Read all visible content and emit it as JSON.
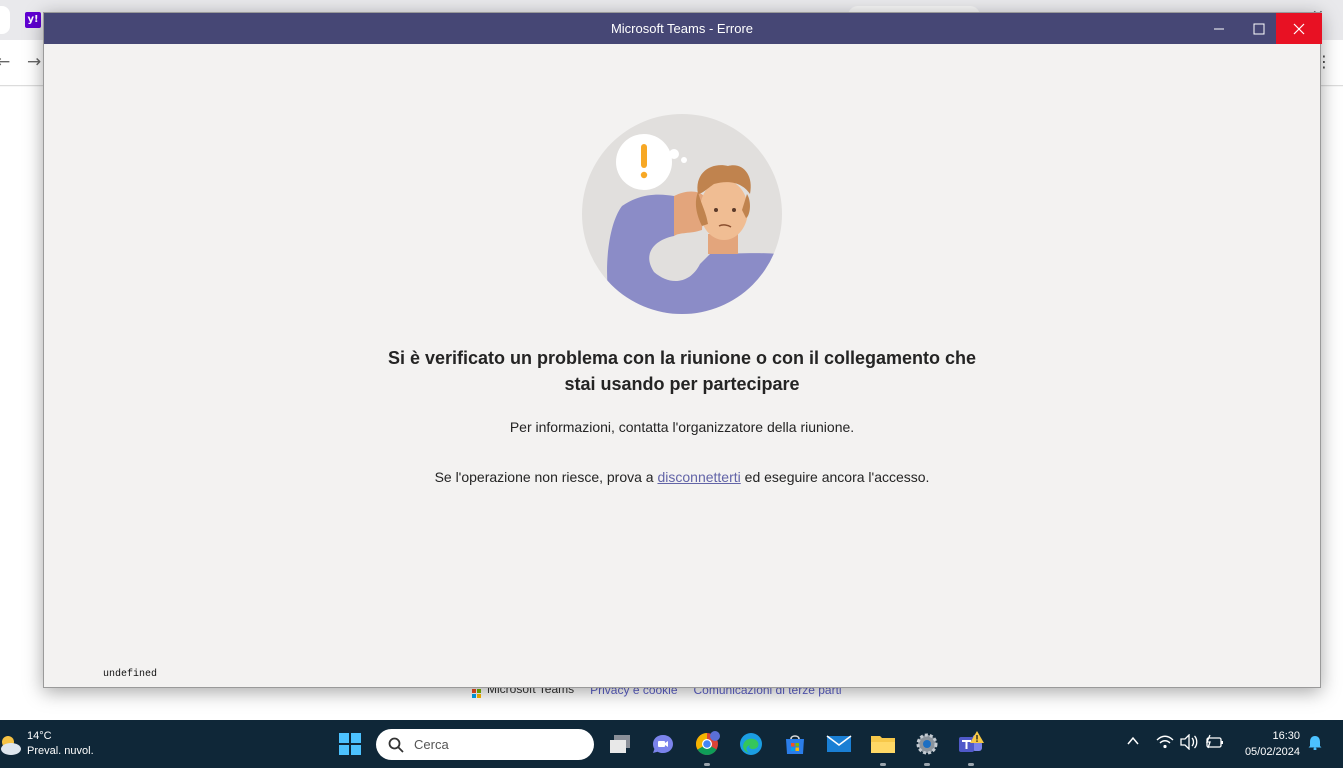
{
  "browser": {
    "tab_icon_text": "y!",
    "footer": {
      "brand": "Microsoft Teams",
      "privacy_link": "Privacy e cookie",
      "third_party_link": "Comunicazioni di terze parti"
    }
  },
  "window": {
    "title": "Microsoft Teams - Errore",
    "heading": "Si è verificato un problema con la riunione o con il collegamento che stai usando per partecipare",
    "info": "Per informazioni, contatta l'organizzatore della riunione.",
    "retry_prefix": "Se l'operazione non riesce, prova a ",
    "retry_link": "disconnetterti",
    "retry_suffix": " ed eseguire ancora l'accesso.",
    "debug_text": "undefined"
  },
  "taskbar": {
    "weather_temp": "14°C",
    "weather_condition": "Preval. nuvol.",
    "search_placeholder": "Cerca",
    "time": "16:30",
    "date": "05/02/2024",
    "icons": [
      "start-icon",
      "search-icon",
      "task-view-icon",
      "teams-chat-icon",
      "chrome-icon",
      "edge-icon",
      "store-icon",
      "mail-icon",
      "file-explorer-icon",
      "settings-icon",
      "teams-icon"
    ]
  },
  "colors": {
    "titlebar": "#464775",
    "close_button": "#e81123",
    "window_background": "#f3f2f1",
    "link": "#6264a7",
    "taskbar": "#0f2738"
  }
}
